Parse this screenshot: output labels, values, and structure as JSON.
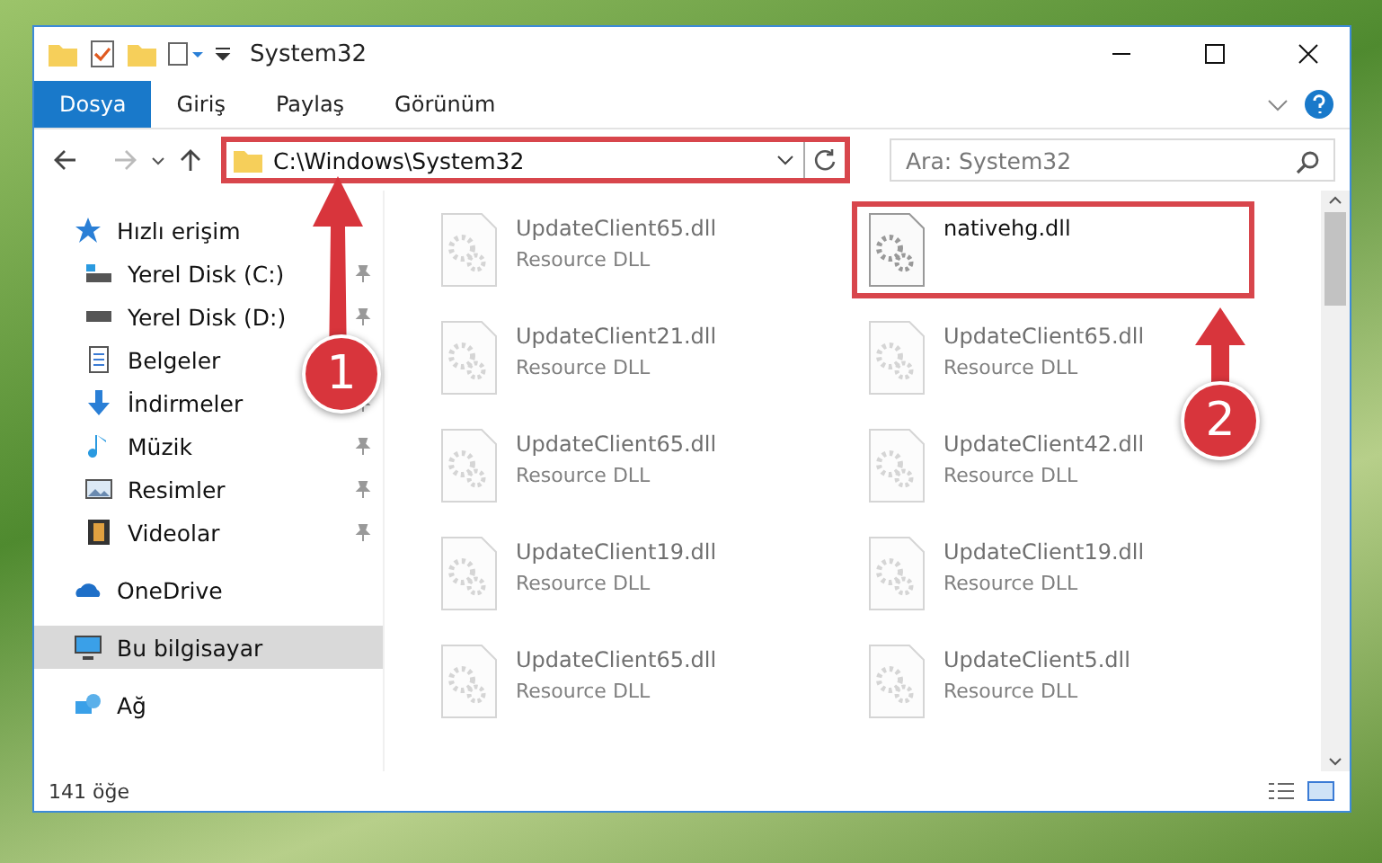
{
  "window": {
    "title": "System32"
  },
  "ribbon_tabs": [
    {
      "label": "Dosya",
      "selected": true
    },
    {
      "label": "Giriş",
      "selected": false
    },
    {
      "label": "Paylaş",
      "selected": false
    },
    {
      "label": "Görünüm",
      "selected": false
    }
  ],
  "address": {
    "path": "C:\\Windows\\System32",
    "highlighted": true
  },
  "search": {
    "placeholder": "Ara: System32"
  },
  "sidebar": {
    "items": [
      {
        "label": "Hızlı erişim",
        "selected": false,
        "children": [
          {
            "label": "Yerel Disk (C:)",
            "selected": false
          },
          {
            "label": "Yerel Disk (D:)",
            "selected": false
          },
          {
            "label": "Belgeler",
            "selected": false
          },
          {
            "label": "İndirmeler",
            "selected": false
          },
          {
            "label": "Müzik",
            "selected": false
          },
          {
            "label": "Resimler",
            "selected": false
          },
          {
            "label": "Videolar",
            "selected": false
          }
        ]
      },
      {
        "label": "OneDrive",
        "selected": false
      },
      {
        "label": "Bu bilgisayar",
        "selected": true
      },
      {
        "label": "Ağ",
        "selected": false
      }
    ]
  },
  "files": [
    {
      "name": "UpdateClient65.dll",
      "type": "Resource DLL",
      "dimmed": true,
      "highlighted": false
    },
    {
      "name": "nativehg.dll",
      "dimmed": false,
      "highlighted": true
    },
    {
      "name": "UpdateClient21.dll",
      "type": "Resource DLL",
      "dimmed": true,
      "highlighted": false
    },
    {
      "name": "UpdateClient65.dll",
      "type": "Resource DLL",
      "dimmed": true,
      "highlighted": false
    },
    {
      "name": "UpdateClient65.dll",
      "type": "Resource DLL",
      "dimmed": true,
      "highlighted": false
    },
    {
      "name": "UpdateClient42.dll",
      "type": "Resource DLL",
      "dimmed": true,
      "highlighted": false
    },
    {
      "name": "UpdateClient19.dll",
      "type": "Resource DLL",
      "dimmed": true,
      "highlighted": false
    },
    {
      "name": "UpdateClient19.dll",
      "type": "Resource DLL",
      "dimmed": true,
      "highlighted": false
    },
    {
      "name": "UpdateClient65.dll",
      "type": "Resource DLL",
      "dimmed": true,
      "highlighted": false
    },
    {
      "name": "UpdateClient5.dll",
      "type": "Resource DLL",
      "dimmed": true,
      "highlighted": false
    }
  ],
  "status_bar": {
    "count": "141 öğe"
  },
  "annotations": [
    {
      "number": "1"
    },
    {
      "number": "2"
    }
  ]
}
